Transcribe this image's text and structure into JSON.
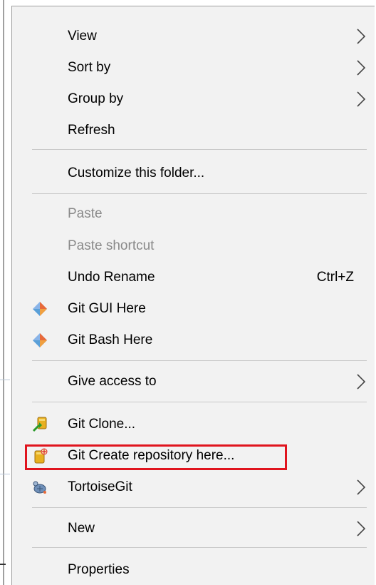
{
  "menu": {
    "items": [
      {
        "label": "View"
      },
      {
        "label": "Sort by"
      },
      {
        "label": "Group by"
      },
      {
        "label": "Refresh"
      },
      {
        "label": "Customize this folder..."
      },
      {
        "label": "Paste"
      },
      {
        "label": "Paste shortcut"
      },
      {
        "label": "Undo Rename",
        "shortcut": "Ctrl+Z"
      },
      {
        "label": "Git GUI Here",
        "icon": "git-icon"
      },
      {
        "label": "Git Bash Here",
        "icon": "git-icon"
      },
      {
        "label": "Give access to"
      },
      {
        "label": "Git Clone...",
        "icon": "git-clone-icon"
      },
      {
        "label": "Git Create repository here...",
        "icon": "git-create-repo-icon"
      },
      {
        "label": "TortoiseGit",
        "icon": "tortoisegit-icon"
      },
      {
        "label": "New"
      },
      {
        "label": "Properties"
      }
    ]
  },
  "colors": {
    "menu_bg": "#f2f2f2",
    "highlight_border": "#e0141e",
    "disabled_text": "#8a8a8a"
  }
}
